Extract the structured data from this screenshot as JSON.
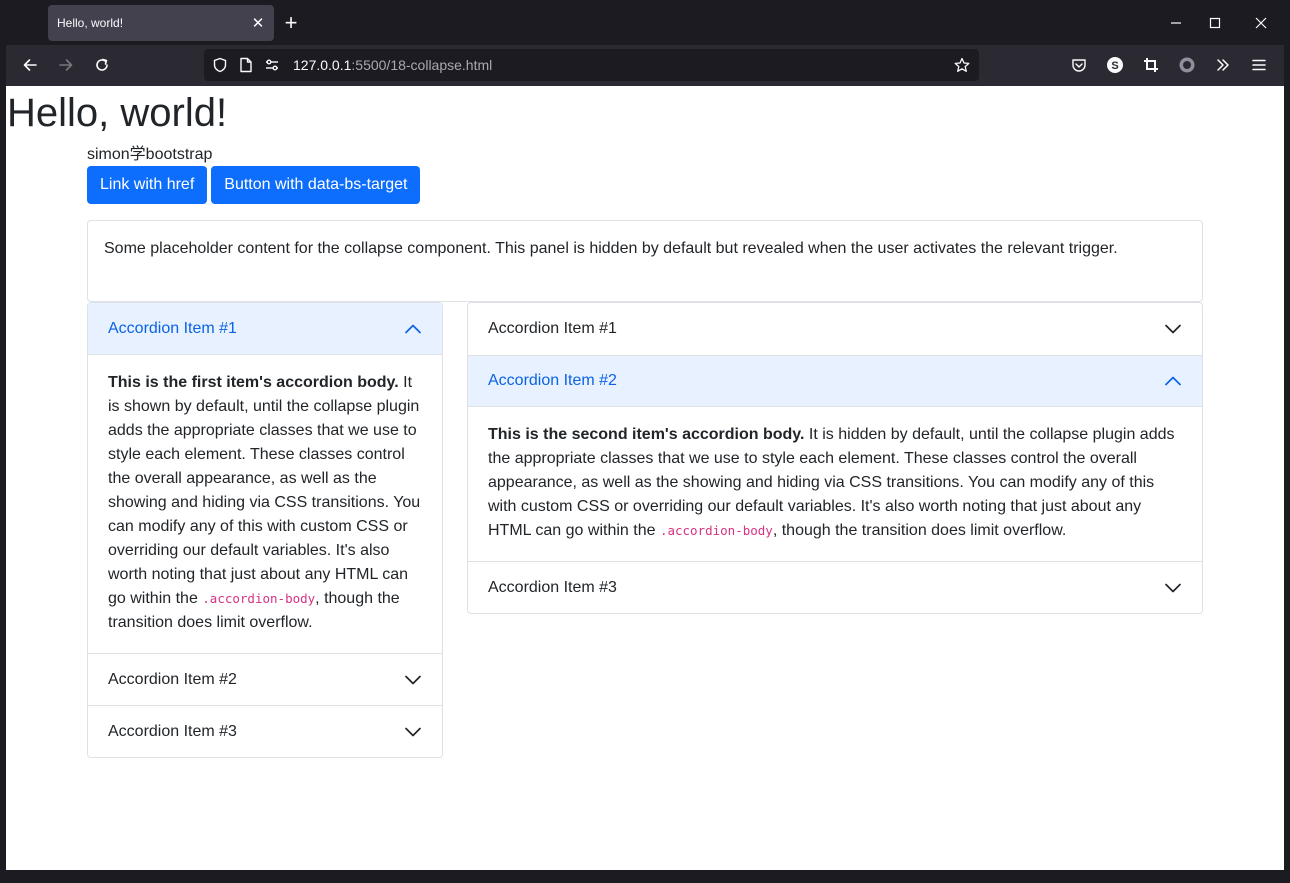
{
  "browser": {
    "tab_title": "Hello, world!",
    "tab_close": "✕",
    "new_tab": "+",
    "url_host": "127.0.0.1",
    "url_path": ":5500/18-collapse.html"
  },
  "page": {
    "title": "Hello, world!",
    "subtitle": "simon学bootstrap",
    "buttons": {
      "link": "Link with href",
      "target": "Button with data-bs-target"
    },
    "collapse_text": "Some placeholder content for the collapse component. This panel is hidden by default but revealed when the user activates the relevant trigger."
  },
  "accordion_left": {
    "items": [
      {
        "header": "Accordion Item #1",
        "open": true,
        "body_strong": "This is the first item's accordion body.",
        "body_text": " It is shown by default, until the collapse plugin adds the appropriate classes that we use to style each element. These classes control the overall appearance, as well as the showing and hiding via CSS transitions. You can modify any of this with custom CSS or overriding our default variables. It's also worth noting that just about any HTML can go within the ",
        "body_code": ".accordion-body",
        "body_tail": ", though the transition does limit overflow."
      },
      {
        "header": "Accordion Item #2",
        "open": false
      },
      {
        "header": "Accordion Item #3",
        "open": false
      }
    ]
  },
  "accordion_right": {
    "items": [
      {
        "header": "Accordion Item #1",
        "open": false
      },
      {
        "header": "Accordion Item #2",
        "open": true,
        "body_strong": "This is the second item's accordion body.",
        "body_text": " It is hidden by default, until the collapse plugin adds the appropriate classes that we use to style each element. These classes control the overall appearance, as well as the showing and hiding via CSS transitions. You can modify any of this with custom CSS or overriding our default variables. It's also worth noting that just about any HTML can go within the ",
        "body_code": ".accordion-body",
        "body_tail": ", though the transition does limit overflow."
      },
      {
        "header": "Accordion Item #3",
        "open": false
      }
    ]
  },
  "colors": {
    "primary": "#0d6efd",
    "accordion_active_bg": "#e7f1ff",
    "accordion_active_text": "#0c63e4",
    "code": "#d63384"
  },
  "icons": [
    "back-icon",
    "forward-icon",
    "reload-icon",
    "shield-icon",
    "page-icon",
    "permissions-icon",
    "bookmark-star-icon",
    "pocket-icon",
    "account-icon",
    "crop-icon",
    "extension-icon",
    "overflow-icon",
    "menu-icon",
    "minimize-icon",
    "maximize-icon",
    "window-close-icon",
    "chevron-up-icon",
    "chevron-down-icon"
  ]
}
